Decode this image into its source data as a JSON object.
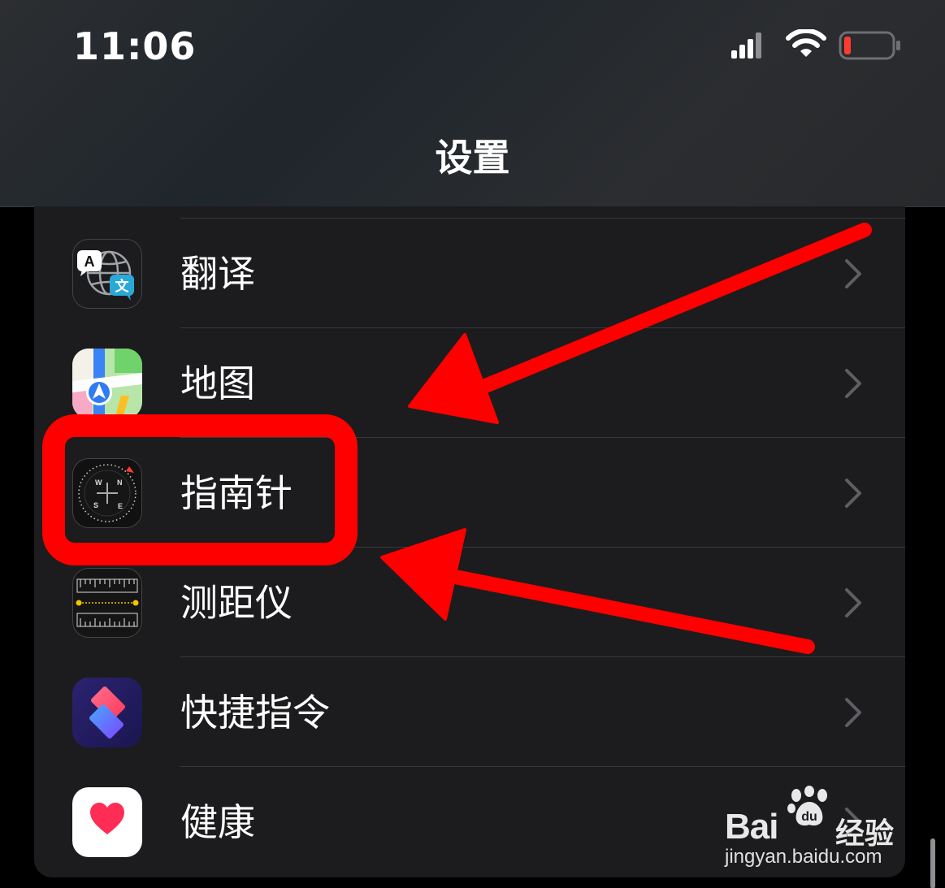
{
  "status_bar": {
    "time": "11:06",
    "signal_icon": "cellular-signal-icon",
    "wifi_icon": "wifi-icon",
    "battery_icon": "battery-low-icon",
    "battery_color": "#ff3b30"
  },
  "header": {
    "title": "设置"
  },
  "settings_list": [
    {
      "label": "翻译",
      "icon": "translate-app-icon"
    },
    {
      "label": "地图",
      "icon": "maps-app-icon"
    },
    {
      "label": "指南针",
      "icon": "compass-app-icon",
      "highlighted": true
    },
    {
      "label": "测距仪",
      "icon": "measure-app-icon"
    },
    {
      "label": "快捷指令",
      "icon": "shortcuts-app-icon"
    },
    {
      "label": "健康",
      "icon": "health-app-icon"
    }
  ],
  "compass_letters": {
    "n": "N",
    "s": "S",
    "e": "E",
    "w": "W"
  },
  "translate_letters": {
    "a": "A",
    "wen": "文"
  },
  "annotation": {
    "color": "#ff0000"
  },
  "watermark": {
    "brand": "Bai",
    "brand_cn": "经验",
    "url": "jingyan.baidu.com"
  }
}
